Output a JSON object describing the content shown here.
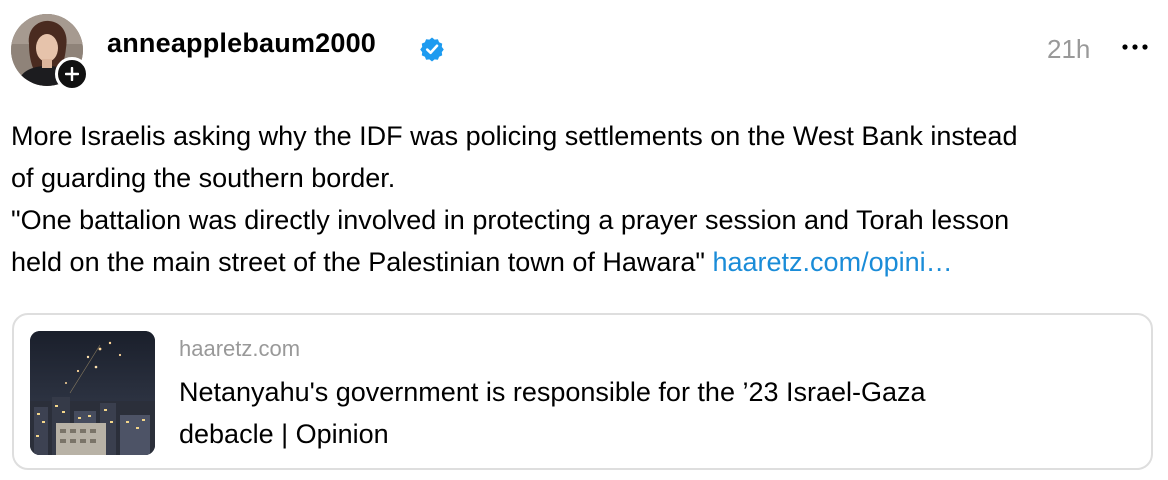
{
  "post": {
    "username": "anneapplebaum2000",
    "timestamp": "21h",
    "text_lines": [
      "More Israelis asking why the IDF was policing settlements on the West Bank instead",
      "of guarding the southern border.",
      "\"One battalion was directly involved in protecting a prayer session and Torah lesson",
      "held on the main street of the Palestinian town of Hawara\""
    ],
    "link_text": "haaretz.com/opini…",
    "icons": {
      "verified": "verified-badge-icon",
      "follow": "plus-icon",
      "more": "more-options-icon"
    },
    "colors": {
      "link": "#1a8cd8",
      "verified": "#1d9bf0",
      "muted": "#999999"
    }
  },
  "link_card": {
    "domain": "haaretz.com",
    "title_lines": [
      "Netanyahu's government is responsible for the ’23 Israel-Gaza",
      "debacle | Opinion"
    ]
  }
}
